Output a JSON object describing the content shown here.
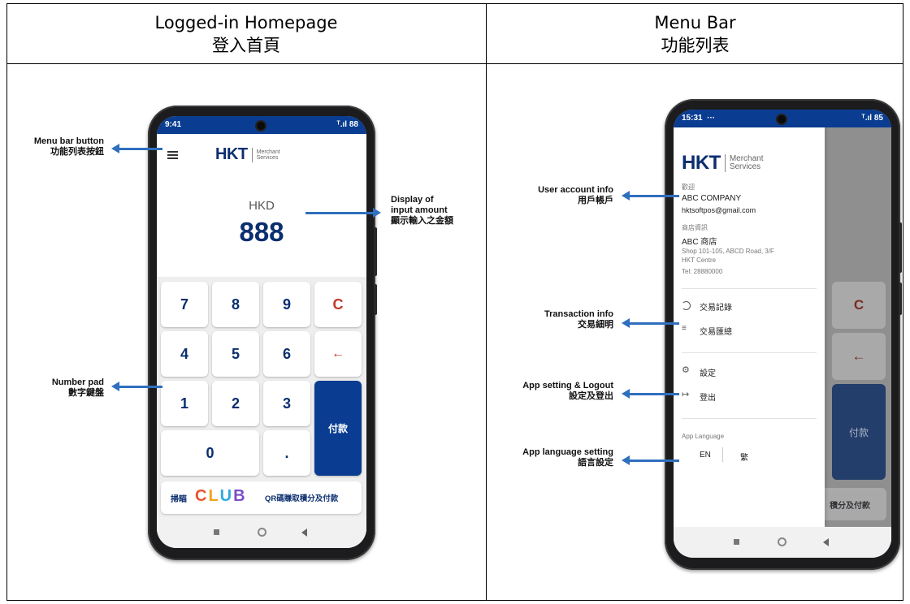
{
  "headers": {
    "left_en": "Logged-in Homepage",
    "left_zh": "登入首頁",
    "right_en": "Menu Bar",
    "right_zh": "功能列表"
  },
  "colors": {
    "brand_blue": "#0a3d91",
    "arrow_blue": "#2f6fbf",
    "clear_red": "#c0392b"
  },
  "home": {
    "status_time": "9:41",
    "status_right": "ᵀ.ıl 88",
    "logo_hkt": "HKT",
    "logo_ms1": "Merchant",
    "logo_ms2": "Services",
    "currency": "HKD",
    "amount": "888",
    "keys": {
      "k7": "7",
      "k8": "8",
      "k9": "9",
      "clear": "C",
      "k4": "4",
      "k5": "5",
      "k6": "6",
      "back": "←",
      "k1": "1",
      "k2": "2",
      "k3": "3",
      "pay": "付款",
      "k0": "0",
      "dot": "."
    },
    "club_scan": "掃瞄",
    "club_logo": "CLUB",
    "club_text": "QR碼賺取積分及付款"
  },
  "home_annotations": {
    "menu_en": "Menu bar button",
    "menu_zh": "功能列表按鈕",
    "amount_en1": "Display of",
    "amount_en2": "input amount",
    "amount_zh": "顯示輸入之金額",
    "pad_en": "Number pad",
    "pad_zh": "數字鍵盤"
  },
  "menu": {
    "status_time": "15:31",
    "status_dots": "···",
    "status_right": "ᵀ.ıl 85",
    "logo_hkt": "HKT",
    "logo_ms1": "Merchant",
    "logo_ms2": "Services",
    "welcome_label": "歡迎",
    "company": "ABC COMPANY",
    "email": "hktsoftpos@gmail.com",
    "shop_label": "商店資訊",
    "shop_name": "ABC 商店",
    "address1": "Shop 101-105, ABCD Road, 3/F",
    "address2": "HKT Centre",
    "tel": "Tel: 28880000",
    "item_history": "交易記錄",
    "item_summary": "交易匯總",
    "item_settings": "設定",
    "item_logout": "登出",
    "lang_label": "App Language",
    "lang_en": "EN",
    "lang_zh": "繁",
    "bg_clear": "C",
    "bg_back": "←",
    "bg_pay": "付款",
    "bg_club": "積分及付款"
  },
  "menu_annotations": {
    "user_en": "User account info",
    "user_zh": "用戶帳戶",
    "tx_en": "Transaction info",
    "tx_zh": "交易細明",
    "setting_en": "App setting & Logout",
    "setting_zh": "設定及登出",
    "lang_en": "App language setting",
    "lang_zh": "語言設定"
  },
  "icons": [
    "menu-icon",
    "history-icon",
    "summary-icon",
    "settings-icon",
    "logout-icon",
    "camera-icon",
    "nav-home-icon",
    "nav-back-icon",
    "nav-recents-icon"
  ]
}
